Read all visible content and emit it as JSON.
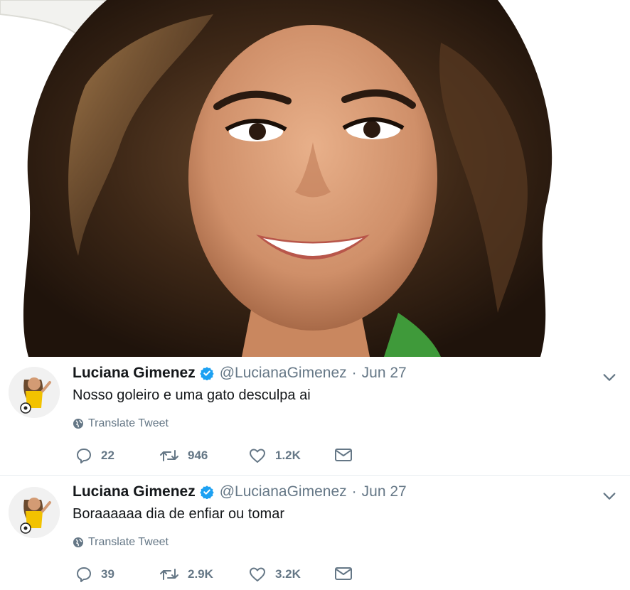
{
  "colors": {
    "verified_blue": "#1da1f2",
    "secondary_text": "#657786",
    "primary_text": "#14171a",
    "divider": "#e6ecf0"
  },
  "tweets": [
    {
      "name": "Luciana Gimenez",
      "handle": "@LucianaGimenez",
      "separator": "·",
      "date": "Jun 27",
      "text": "Nosso goleiro e uma gato desculpa ai",
      "translate_label": "Translate Tweet",
      "replies": "22",
      "retweets": "946",
      "likes": "1.2K",
      "icons": [
        "reply-icon",
        "retweet-icon",
        "like-icon",
        "direct-message-icon",
        "globe-icon",
        "chevron-down-icon",
        "verified-badge-icon"
      ]
    },
    {
      "name": "Luciana Gimenez",
      "handle": "@LucianaGimenez",
      "separator": "·",
      "date": "Jun 27",
      "text": "Boraaaaaa dia de enfiar ou tomar",
      "translate_label": "Translate Tweet",
      "replies": "39",
      "retweets": "2.9K",
      "likes": "3.2K",
      "icons": [
        "reply-icon",
        "retweet-icon",
        "like-icon",
        "direct-message-icon",
        "globe-icon",
        "chevron-down-icon",
        "verified-badge-icon"
      ]
    }
  ]
}
